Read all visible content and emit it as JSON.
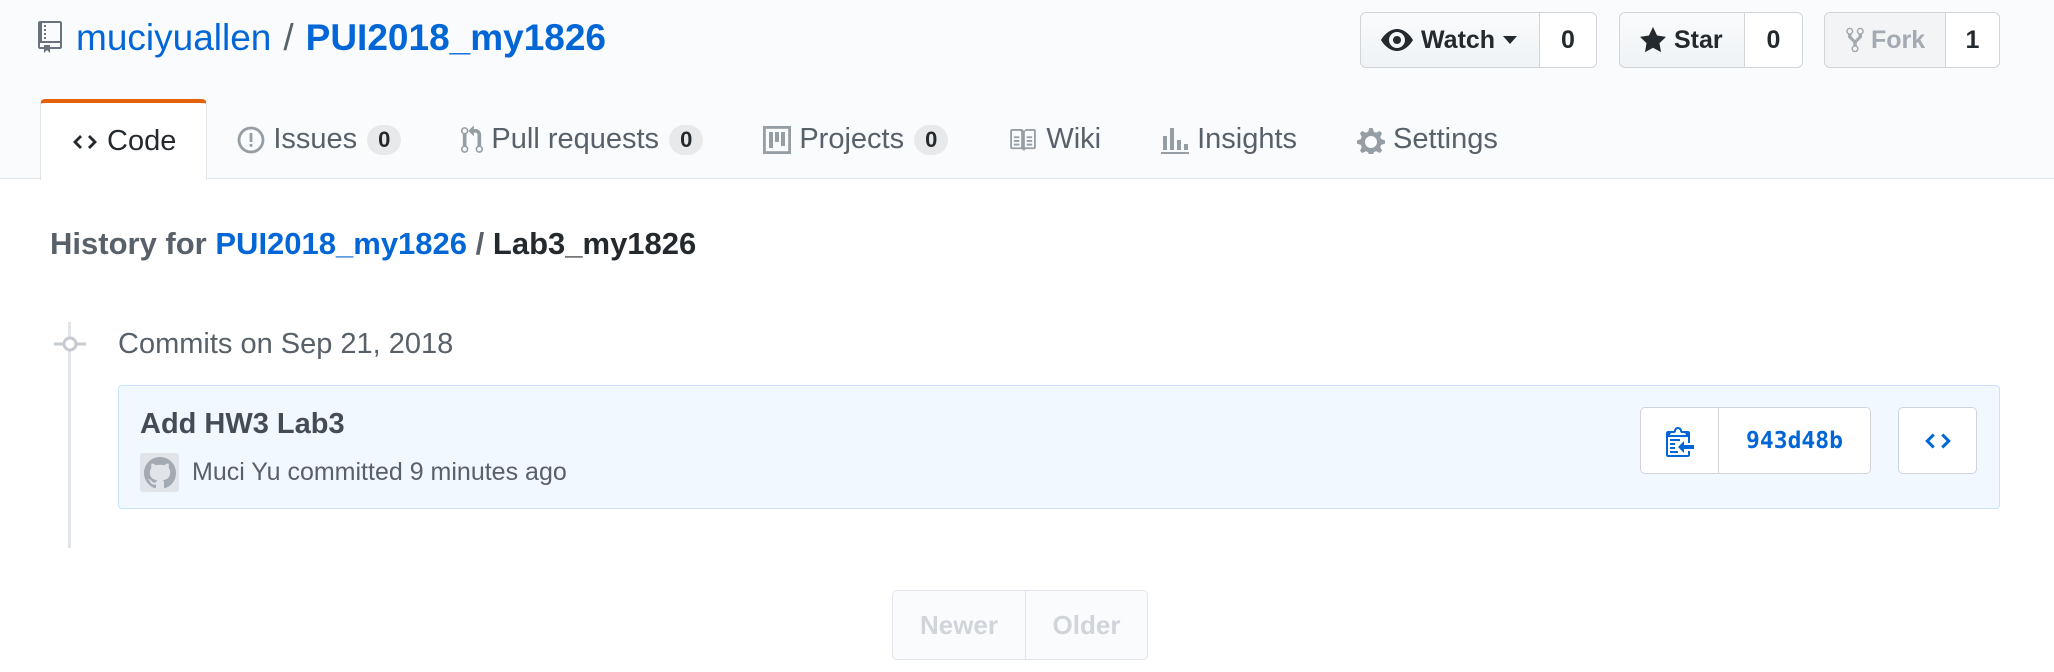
{
  "repo": {
    "owner": "muciyuallen",
    "separator": "/",
    "name": "PUI2018_my1826",
    "icon": "repo-book-icon"
  },
  "actions": {
    "watch": {
      "label": "Watch",
      "count": "0",
      "icon": "eye-icon"
    },
    "star": {
      "label": "Star",
      "count": "0",
      "icon": "star-icon"
    },
    "fork": {
      "label": "Fork",
      "count": "1",
      "icon": "fork-icon"
    }
  },
  "tabs": [
    {
      "label": "Code",
      "icon": "code-icon",
      "selected": true
    },
    {
      "label": "Issues",
      "counter": "0",
      "icon": "issue-icon"
    },
    {
      "label": "Pull requests",
      "counter": "0",
      "icon": "pull-request-icon"
    },
    {
      "label": "Projects",
      "counter": "0",
      "icon": "project-icon"
    },
    {
      "label": "Wiki",
      "icon": "book-icon"
    },
    {
      "label": "Insights",
      "icon": "graph-icon"
    },
    {
      "label": "Settings",
      "icon": "gear-icon"
    }
  ],
  "history": {
    "prefix": "History for",
    "repo_link": "PUI2018_my1826",
    "separator": "/",
    "path": "Lab3_my1826"
  },
  "commit_group": {
    "date_label": "Commits on Sep 21, 2018"
  },
  "commit": {
    "title": "Add HW3 Lab3",
    "author": "Muci Yu",
    "action_text": "committed",
    "time": "9 minutes ago",
    "sha": "943d48b",
    "copy_icon": "clippy-icon",
    "browse_icon": "code-icon"
  },
  "pagination": {
    "newer": "Newer",
    "older": "Older"
  },
  "colors": {
    "link": "#0366d6",
    "selected_tab_accent": "#e36209",
    "commit_bg": "#f1f8ff"
  }
}
